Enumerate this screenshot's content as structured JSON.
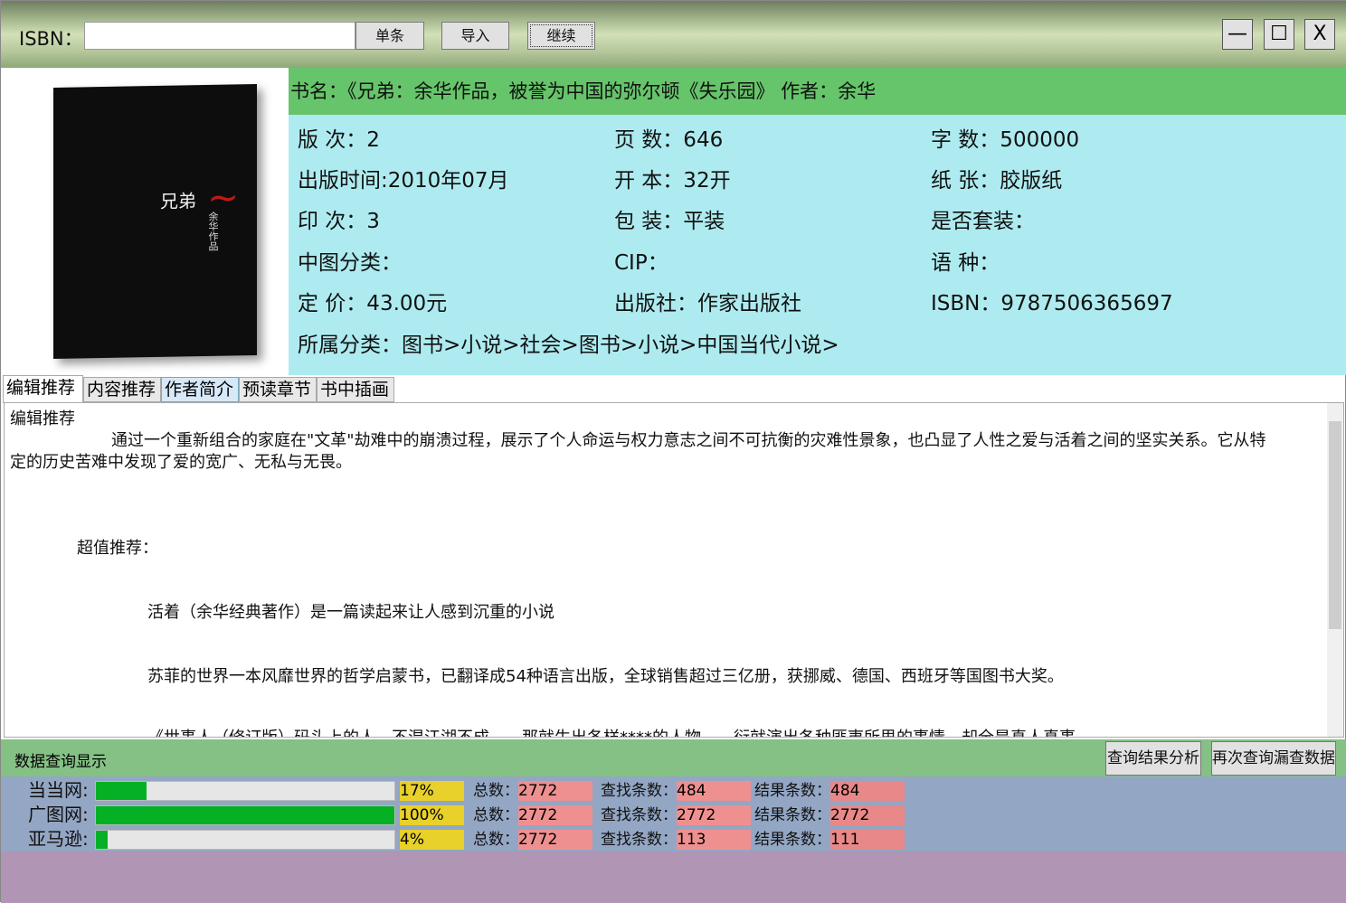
{
  "toolbar": {
    "isbn_label": "ISBN：",
    "isbn_value": "",
    "single": "单条",
    "import": "导入",
    "continue": "继续"
  },
  "window": {
    "minimize": "—",
    "maximize": "☐",
    "close": "X"
  },
  "book": {
    "cover_title": "兄弟",
    "cover_subtitle": "余华作品",
    "cover_signature": "余华",
    "title_line": "书名：《兄弟：余华作品，被誉为中国的弥尔顿《失乐园》 作者：余华",
    "fields": [
      [
        "版 次：2",
        "页 数：646",
        "字 数：500000"
      ],
      [
        "出版时间:2010年07月",
        "开 本：32开",
        "纸 张：胶版纸"
      ],
      [
        "印 次：3",
        "包 装：平装",
        "是否套装："
      ],
      [
        "中图分类：",
        "CIP：",
        "语 种："
      ],
      [
        "定 价：43.00元",
        "出版社：作家出版社",
        "ISBN：9787506365697"
      ]
    ],
    "category": "所属分类：图书>小说>社会>图书>小说>中国当代小说>"
  },
  "tabs": [
    "编辑推荐",
    "内容推荐",
    "作者简介",
    "预读章节",
    "书中插画"
  ],
  "content": {
    "heading": "编辑推荐",
    "para1a": "通过一个重新组合的家庭在\"文革\"劫难中的崩溃过程，展示了个人命运与权力意志之间不可抗衡的灾难性景象，也凸显了人性之爱与活着之间的坚实关系。它从特",
    "para1b": "定的历史苦难中发现了爱的宽广、无私与无畏。",
    "super": "超值推荐：",
    "rec1": "活着（余华经典著作）是一篇读起来让人感到沉重的小说",
    "rec2": "苏菲的世界一本风靡世界的哲学启蒙书，已翻译成54种语言出版，全球销售超过三亿册，获挪威、德国、西班牙等国图书大奖。",
    "rec3": "《世事人（修订版）码头上的人，不混江湖不成……那就生出各样****的人物……衍就演出各种匪夷所思的事情，却全是真人真事"
  },
  "query": {
    "label": "数据查询显示",
    "analyze": "查询结果分析",
    "requery": "再次查询漏查数据"
  },
  "stats": [
    {
      "site": "当当网:",
      "progress": 17,
      "pct": "17%",
      "total_label": "总数：",
      "total": "2772",
      "found_label": "查找条数：",
      "found": "484",
      "result_label": "结果条数：",
      "result": "484"
    },
    {
      "site": "广图网:",
      "progress": 100,
      "pct": "100%",
      "total_label": "总数：",
      "total": "2772",
      "found_label": "查找条数：",
      "found": "2772",
      "result_label": "结果条数：",
      "result": "2772"
    },
    {
      "site": "亚马逊:",
      "progress": 4,
      "pct": "4%",
      "total_label": "总数：",
      "total": "2772",
      "found_label": "查找条数：",
      "found": "113",
      "result_label": "结果条数：",
      "result": "111"
    }
  ]
}
